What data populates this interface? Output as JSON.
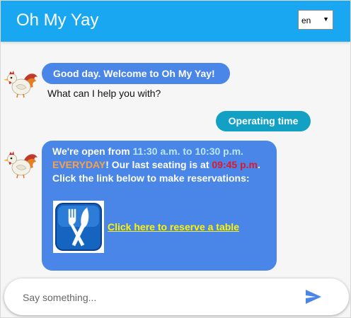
{
  "header": {
    "title": "Oh My Yay",
    "language": {
      "selected": "en",
      "arrow": "▼"
    }
  },
  "messages": {
    "greeting": "Good day. Welcome to Oh My Yay!",
    "help_prompt": "What can I help you with?",
    "user_message": "Operating time",
    "hours_reply": {
      "part1": "We're open from ",
      "time_range": "11:30 a.m. to 10:30 p.m.",
      "part2": " ",
      "everyday": "EVERYDAY",
      "part3": "! Our last seating is at ",
      "last_seating": "09:45 p.m",
      "part4": ". Click the link below to make reservations:"
    },
    "reserve_link": "Click here to reserve a table"
  },
  "input": {
    "placeholder": "Say something...",
    "value": ""
  },
  "colors": {
    "header": "#1aa7f2",
    "bot_bubble": "#4a86e8",
    "user_bubble": "#12a0c4",
    "time_highlight": "#b9e6f7",
    "everyday_highlight": "#f7a24a",
    "seating_highlight": "#e0182a",
    "link": "#fff200"
  },
  "icons": {
    "bot_avatar": "rooster-icon",
    "reservation": "cutlery-icon",
    "send": "send-icon",
    "dropdown": "chevron-down-icon"
  }
}
